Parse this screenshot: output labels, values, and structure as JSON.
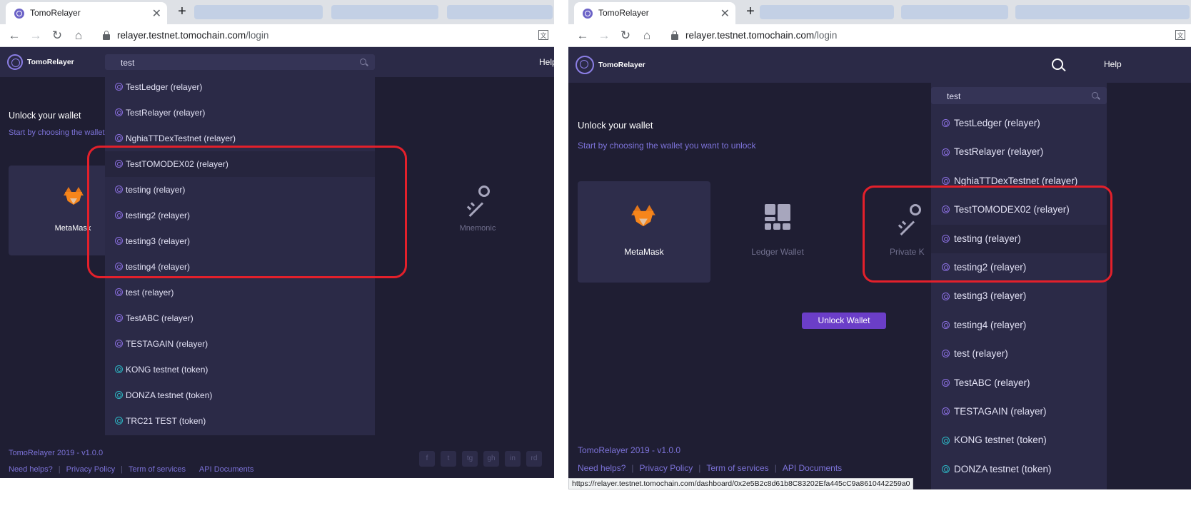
{
  "browser": {
    "tab_title": "TomoRelayer",
    "tab_close": "✕",
    "new_tab": "+",
    "url_host": "relayer.testnet.tomochain.com",
    "url_path": "/login",
    "status_url": "https://relayer.testnet.tomochain.com/dashboard/0x2e5B2c8d61b8C83202Efa445cC9a8610442259a0"
  },
  "header": {
    "brand": "TomoRelayer",
    "help": "Help"
  },
  "search": {
    "value": "test"
  },
  "unlock": {
    "title": "Unlock your wallet",
    "subtitle": "Start by choosing the wallet you want to unlock",
    "left_subtitle": "Start by choosing the wallet",
    "button": "Unlock Wallet"
  },
  "wallets": [
    {
      "label": "MetaMask"
    },
    {
      "label": "Ledger Wallet"
    },
    {
      "label": "Private Key"
    },
    {
      "label": "Mnemonic"
    }
  ],
  "right_private_key_label": "Private K",
  "dropdown": [
    {
      "label": "TestLedger (relayer)",
      "kind": "relayer"
    },
    {
      "label": "TestRelayer (relayer)",
      "kind": "relayer"
    },
    {
      "label": "NghiaTTDexTestnet (relayer)",
      "kind": "relayer"
    },
    {
      "label": "TestTOMODEX02 (relayer)",
      "kind": "relayer"
    },
    {
      "label": "testing (relayer)",
      "kind": "relayer"
    },
    {
      "label": "testing2 (relayer)",
      "kind": "relayer"
    },
    {
      "label": "testing3 (relayer)",
      "kind": "relayer"
    },
    {
      "label": "testing4 (relayer)",
      "kind": "relayer"
    },
    {
      "label": "test (relayer)",
      "kind": "relayer"
    },
    {
      "label": "TestABC (relayer)",
      "kind": "relayer"
    },
    {
      "label": "TESTAGAIN (relayer)",
      "kind": "relayer"
    },
    {
      "label": "KONG testnet (token)",
      "kind": "token"
    },
    {
      "label": "DONZA testnet (token)",
      "kind": "token"
    },
    {
      "label": "TRC21 TEST (token)",
      "kind": "token"
    }
  ],
  "footer": {
    "version": "TomoRelayer 2019 - v1.0.0",
    "links": [
      "Need helps?",
      "Privacy Policy",
      "Term of services",
      "API Documents"
    ],
    "separator": "|",
    "social": [
      "f",
      "t",
      "tg",
      "gh",
      "in",
      "rd"
    ]
  },
  "colors": {
    "background": "#1f1e33",
    "header": "#2b2a47",
    "accent": "#7c72d8",
    "button": "#6b3ec8",
    "highlight": "#e3202b"
  }
}
